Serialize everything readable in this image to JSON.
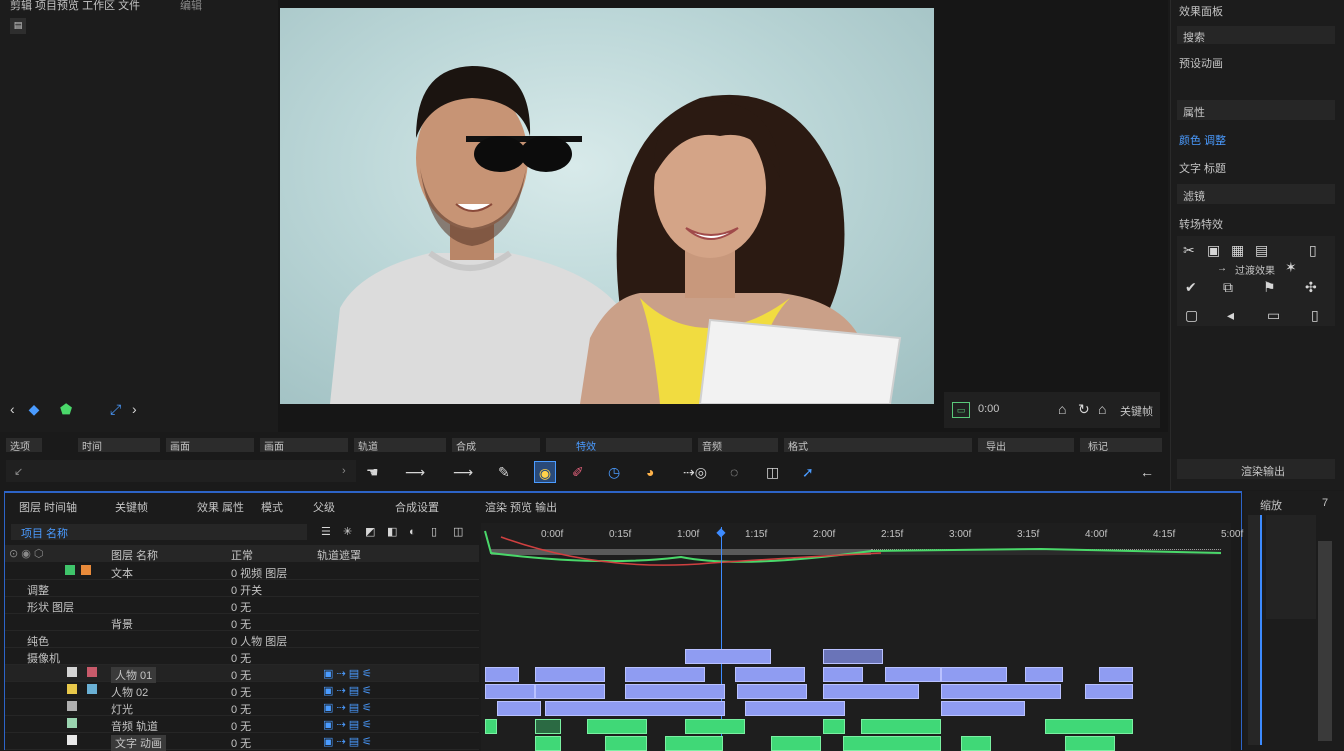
{
  "top_left": {
    "title": "剪辑 项目预览 工作区 文件",
    "menu": "编辑"
  },
  "preview_controls": {
    "timecode": "0:00",
    "status_label": "关键帧"
  },
  "right_panel": {
    "header": "效果面板",
    "field_1": "搜索",
    "section_1": "预设动画",
    "field_2": "属性",
    "item_blue": "颜色 调整",
    "item_2": "文字 标题",
    "field_3": "滤镜",
    "section_2": "转场特效",
    "grid_label": "过渡效果",
    "bottom_label": "渲染输出"
  },
  "toolbar_strip": {
    "labels": [
      "选项",
      "时间",
      "画面",
      "画面",
      "轨道",
      "合成",
      "特效",
      "音频",
      "格式",
      "导出",
      "标记"
    ]
  },
  "timeline": {
    "tabs": [
      "图层 时间轴",
      "关键帧",
      "效果 属性",
      "模式",
      "父级",
      "合成设置",
      "渲染 预览 输出"
    ],
    "search_label": "项目 名称",
    "ruler_labels": [
      "0:00f",
      "0:15f",
      "1:00f",
      "1:15f",
      "2:00f",
      "2:15f",
      "3:00f",
      "3:15f",
      "4:00f",
      "4:15f",
      "5:00f"
    ],
    "layers": [
      {
        "name": "图层 名称",
        "mode": "正常",
        "extra": "轨道遮罩"
      },
      {
        "name": "文本",
        "mode": "0 视频 图层"
      },
      {
        "name": "调整",
        "mode": "0 开关"
      },
      {
        "name": "形状 图层",
        "mode": "0 无"
      },
      {
        "name": "背景",
        "mode": "0 无"
      },
      {
        "name": "纯色",
        "mode": "0 人物 图层"
      },
      {
        "name": "摄像机",
        "mode": "0 无"
      },
      {
        "name": "人物 01",
        "mode": "0 无"
      },
      {
        "name": "人物 02",
        "mode": "0 无"
      },
      {
        "name": "灯光",
        "mode": "0 无"
      },
      {
        "name": "音频 轨道",
        "mode": "0 无"
      },
      {
        "name": "文字 动画",
        "mode": "0 无"
      }
    ],
    "right_mini": {
      "header": "缩放",
      "value": "7"
    }
  }
}
